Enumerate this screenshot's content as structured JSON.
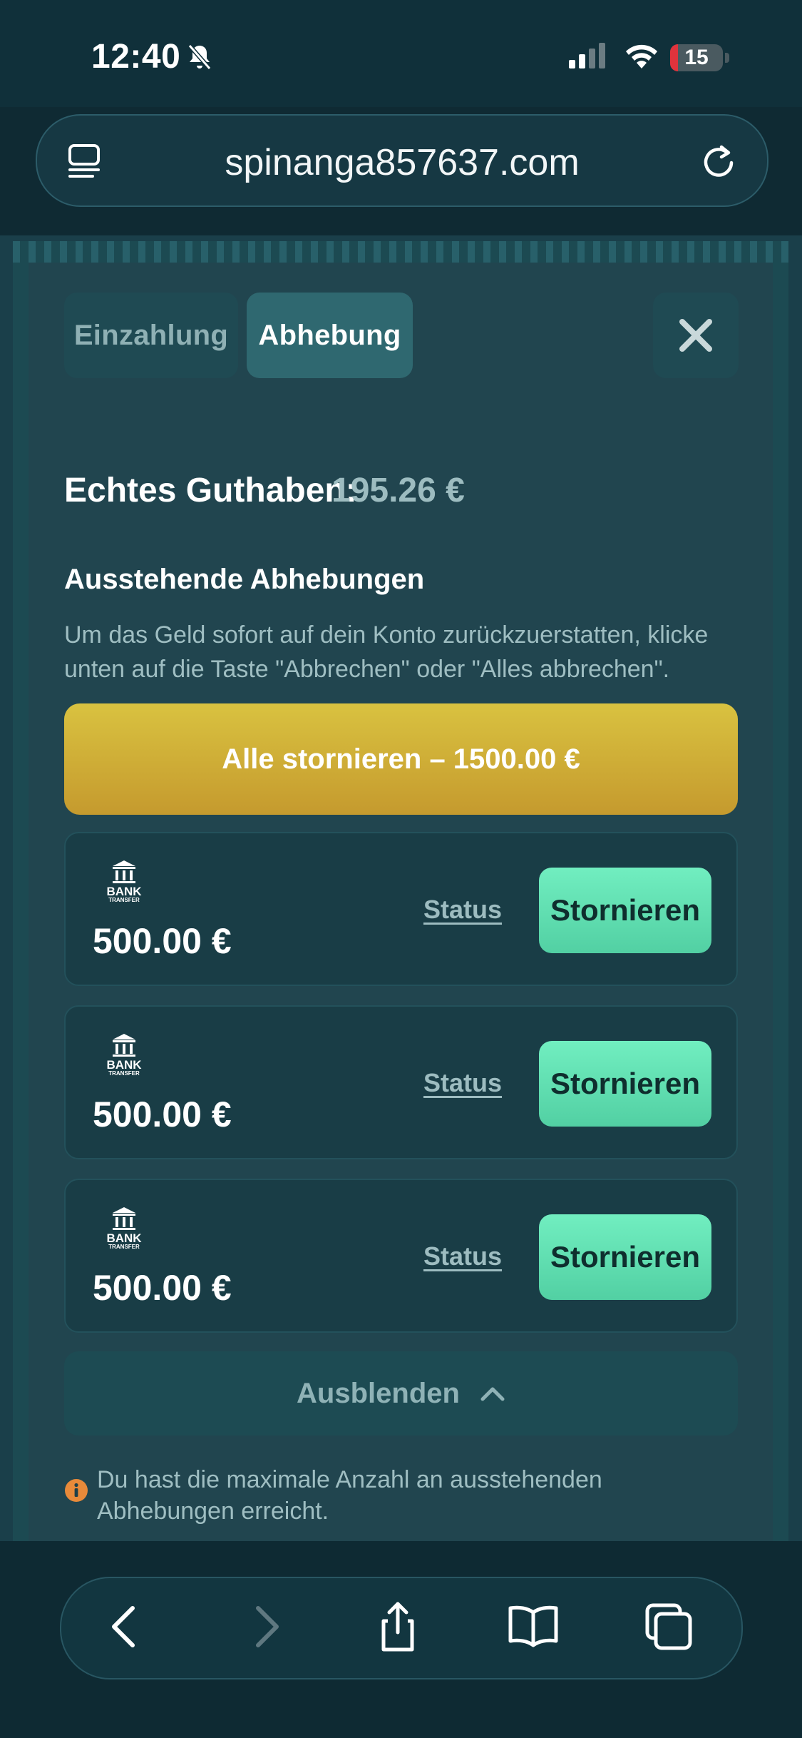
{
  "status_bar": {
    "time": "12:40",
    "battery_percent": "15",
    "battery_level": 0.15,
    "battery_color": "#e0333c"
  },
  "browser": {
    "url": "spinanga857637.com",
    "tabs_icon": "tabs-icon",
    "reload_icon": "reload-icon"
  },
  "modal": {
    "tabs": [
      {
        "label": "Einzahlung",
        "active": false
      },
      {
        "label": "Abhebung",
        "active": true
      }
    ],
    "close_icon": "close-icon",
    "balance_label": "Echtes Guthaben:",
    "balance_value": "195.26 €",
    "pending_title": "Ausstehende Abhebungen",
    "pending_description": "Um das Geld sofort auf dein Konto zurückzuerstatten, klicke unten auf die Taste \"Abbrechen\" oder \"Alles abbrechen\".",
    "cancel_all_label": "Alle stornieren – 1500.00 €",
    "withdrawals": [
      {
        "method_line1": "BANK",
        "method_line2": "TRANSFER",
        "amount": "500.00 €",
        "status_label": "Status",
        "cancel_label": "Stornieren"
      },
      {
        "method_line1": "BANK",
        "method_line2": "TRANSFER",
        "amount": "500.00 €",
        "status_label": "Status",
        "cancel_label": "Stornieren"
      },
      {
        "method_line1": "BANK",
        "method_line2": "TRANSFER",
        "amount": "500.00 €",
        "status_label": "Status",
        "cancel_label": "Stornieren"
      }
    ],
    "hide_label": "Ausblenden",
    "info_text": "Du hast die maximale Anzahl an ausstehenden Abhebungen erreicht.",
    "colors": {
      "accent_gold": "#d9c240",
      "accent_green": "#71eec0",
      "info_orange": "#e88a3a"
    }
  },
  "bottom_nav": {
    "icons": [
      "back-icon",
      "forward-icon",
      "share-icon",
      "bookmarks-icon",
      "tabs-overview-icon"
    ]
  }
}
